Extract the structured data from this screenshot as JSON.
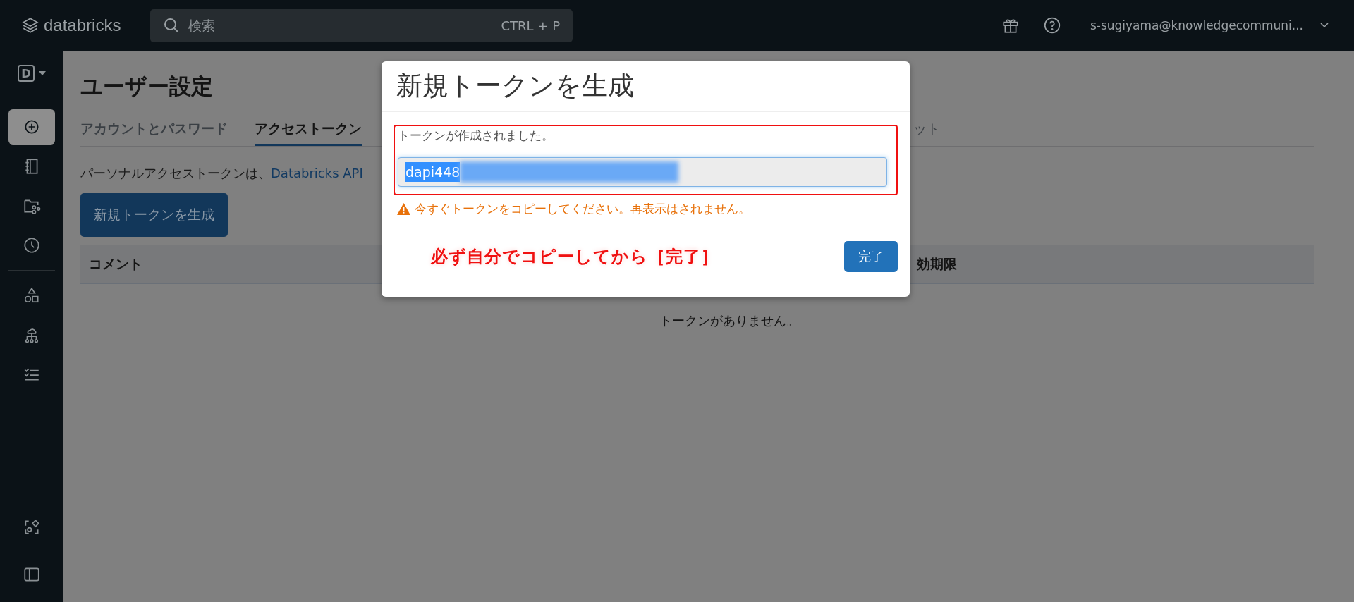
{
  "top_bar": {
    "logo": "databricks",
    "search": {
      "placeholder": "検索",
      "shortcut": "CTRL + P"
    },
    "user": "s-sugiyama@knowledgecommuni..."
  },
  "sidebar": {
    "workspace_badge": "D",
    "items": [
      {
        "kind": "new",
        "selected": true
      },
      {
        "kind": "notebook",
        "selected": false
      },
      {
        "kind": "repos",
        "selected": false
      },
      {
        "kind": "recent",
        "selected": false
      },
      {
        "kind": "catalog",
        "selected": false
      },
      {
        "kind": "workflows",
        "selected": false
      },
      {
        "kind": "tasks",
        "selected": false
      }
    ],
    "bottom_items": [
      {
        "kind": "partner"
      },
      {
        "kind": "panel"
      }
    ]
  },
  "page": {
    "title": "ユーザー設定",
    "tabs": [
      {
        "label": "アカウントとパスワード",
        "selected": false
      },
      {
        "label": "アクセストークン",
        "selected": true
      },
      {
        "label": "ット",
        "selected": false
      }
    ],
    "description": "パーソナルアクセストークンは、",
    "description_link": "Databricks API",
    "generate_button": "新規トークンを生成",
    "table": {
      "columns": [
        "コメント",
        "効期限"
      ],
      "empty_text": "トークンがありません。"
    }
  },
  "dialog": {
    "title": "新規トークンを生成",
    "message": "トークンが作成されました。",
    "token": {
      "value": "dapi448",
      "selected": true
    },
    "warning": "今すぐトークンをコピーしてください。再表示はされません。",
    "done_button": "完了"
  },
  "annotation": {
    "text": "必ず自分でコピーしてから［完了］"
  }
}
